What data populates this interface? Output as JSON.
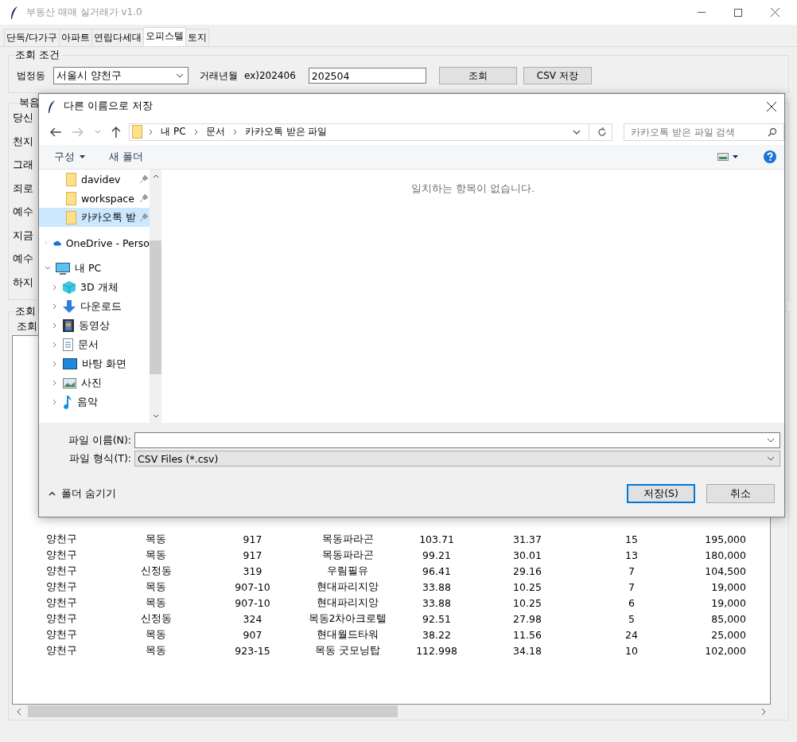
{
  "window": {
    "title": "부동산 매매 실거래가 v1.0"
  },
  "tabs": [
    {
      "label": "단독/다가구",
      "selected": false
    },
    {
      "label": "아파트",
      "selected": false
    },
    {
      "label": "연립다세대",
      "selected": false
    },
    {
      "label": "오피스텔",
      "selected": true
    },
    {
      "label": "토지",
      "selected": false
    }
  ],
  "query": {
    "title": "조회 조건",
    "region_label": "법정동",
    "region_value": "서울시 양천구",
    "month_label": "거래년월",
    "month_hint": "ex)202406",
    "month_value": "202504",
    "buttons": [
      "조회",
      "CSV 저장"
    ]
  },
  "verse_group": {
    "title": "복음",
    "lines": [
      "당신",
      "천지",
      "그래",
      "죄로",
      "예수",
      "지금",
      "예수",
      "하지"
    ]
  },
  "result_group": {
    "title": "조회",
    "label": "조회"
  },
  "table": {
    "rows": [
      [
        "양천구",
        "목동",
        "917",
        "목동파라곤",
        "103.71",
        "31.37",
        "15",
        "195,000"
      ],
      [
        "양천구",
        "목동",
        "917",
        "목동파라곤",
        "99.21",
        "30.01",
        "13",
        "180,000"
      ],
      [
        "양천구",
        "신정동",
        "319",
        "우림필유",
        "96.41",
        "29.16",
        "7",
        "104,500"
      ],
      [
        "양천구",
        "목동",
        "907-10",
        "현대파리지앙",
        "33.88",
        "10.25",
        "7",
        "19,000"
      ],
      [
        "양천구",
        "목동",
        "907-10",
        "현대파리지앙",
        "33.88",
        "10.25",
        "6",
        "19,000"
      ],
      [
        "양천구",
        "신정동",
        "324",
        "목동2차아크로텔",
        "92.51",
        "27.98",
        "5",
        "85,000"
      ],
      [
        "양천구",
        "목동",
        "907",
        "현대월드타워",
        "38.22",
        "11.56",
        "24",
        "25,000"
      ],
      [
        "양천구",
        "목동",
        "923-15",
        "목동 굿모닝탑",
        "112.998",
        "34.18",
        "10",
        "102,000"
      ]
    ]
  },
  "dialog": {
    "title": "다른 이름으로 저장",
    "breadcrumb": [
      "내 PC",
      "문서",
      "카카오톡 받은 파일"
    ],
    "search": {
      "placeholder": "카카오톡 받은 파일 검색"
    },
    "toolbar": [
      "구성",
      "새 폴더"
    ],
    "quick_access": [
      {
        "label": "davidev",
        "kind": "folder",
        "pinned": true,
        "selected": false
      },
      {
        "label": "workspace",
        "kind": "folder",
        "pinned": true,
        "selected": false
      },
      {
        "label": "카카오톡 받",
        "kind": "folder",
        "pinned": true,
        "selected": true
      }
    ],
    "tree": [
      {
        "label": "OneDrive - Perso",
        "kind": "cloud",
        "expanded": false,
        "selected": false
      },
      {
        "label": "내 PC",
        "kind": "pc",
        "expanded": true,
        "selected": false,
        "children": [
          {
            "label": "3D 개체",
            "kind": "cube",
            "expanded": false,
            "selected": false
          },
          {
            "label": "다운로드",
            "kind": "download",
            "expanded": false,
            "selected": false
          },
          {
            "label": "동영상",
            "kind": "video",
            "expanded": false,
            "selected": false
          },
          {
            "label": "문서",
            "kind": "document",
            "expanded": false,
            "selected": false
          },
          {
            "label": "바탕 화면",
            "kind": "desktop",
            "expanded": false,
            "selected": false
          },
          {
            "label": "사진",
            "kind": "pictures",
            "expanded": false,
            "selected": false
          },
          {
            "label": "음악",
            "kind": "music",
            "expanded": false,
            "selected": false
          }
        ]
      }
    ],
    "empty_message": "일치하는 항목이 없습니다.",
    "filename_label": "파일 이름(N):",
    "filetype_label": "파일 형식(T):",
    "filetype_value": "CSV Files (*.csv)",
    "hide_folders": "폴더 숨기기",
    "buttons": [
      {
        "label": "저장(S)",
        "kind": "default"
      },
      {
        "label": "취소",
        "kind": "normal"
      }
    ]
  }
}
